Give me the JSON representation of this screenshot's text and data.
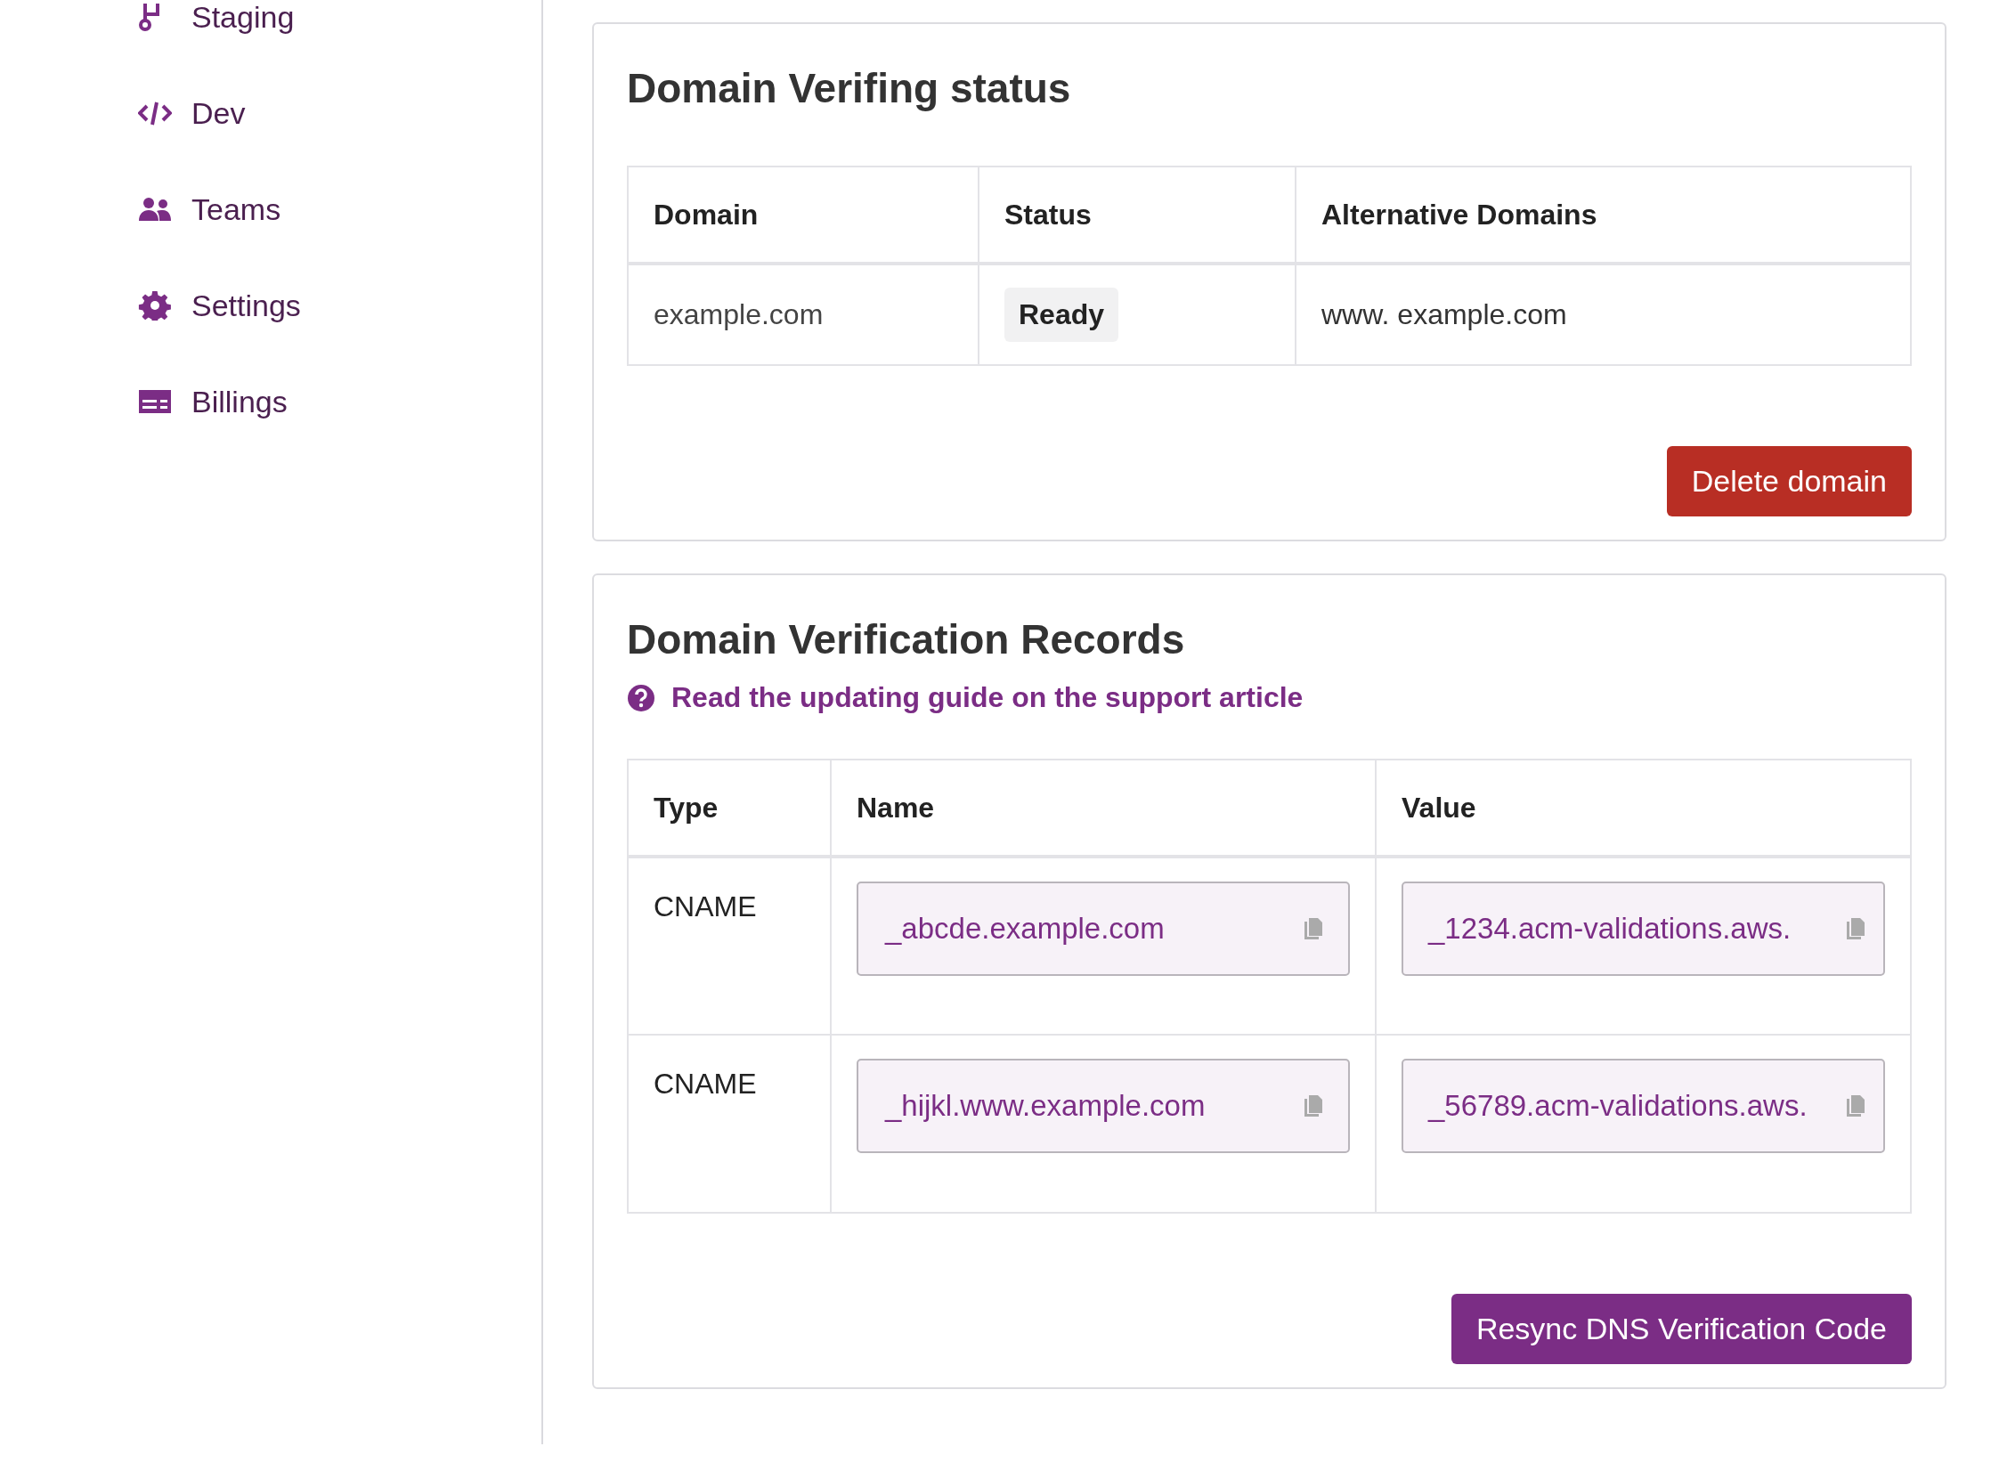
{
  "sidebar": {
    "items": [
      {
        "label": "Staging"
      },
      {
        "label": "Dev"
      },
      {
        "label": "Teams"
      },
      {
        "label": "Settings"
      },
      {
        "label": "Billings"
      }
    ]
  },
  "status_card": {
    "title": "Domain Verifing status",
    "table": {
      "columns": [
        "Domain",
        "Status",
        "Alternative Domains"
      ],
      "rows": [
        {
          "domain": "example.com",
          "status": "Ready",
          "alternative": "www. example.com"
        }
      ]
    },
    "button": "Delete domain"
  },
  "records_card": {
    "title": "Domain Verification Records",
    "help_link": "Read the updating guide on the support article",
    "table": {
      "columns": [
        "Type",
        "Name",
        "Value"
      ],
      "rows": [
        {
          "type": "CNAME",
          "name": "_abcde.example.com",
          "value": "_1234.acm-validations.aws."
        },
        {
          "type": "CNAME",
          "name": "_hijkl.www.example.com",
          "value": "_56789.acm-validations.aws."
        }
      ]
    },
    "button": "Resync DNS Verification Code"
  }
}
